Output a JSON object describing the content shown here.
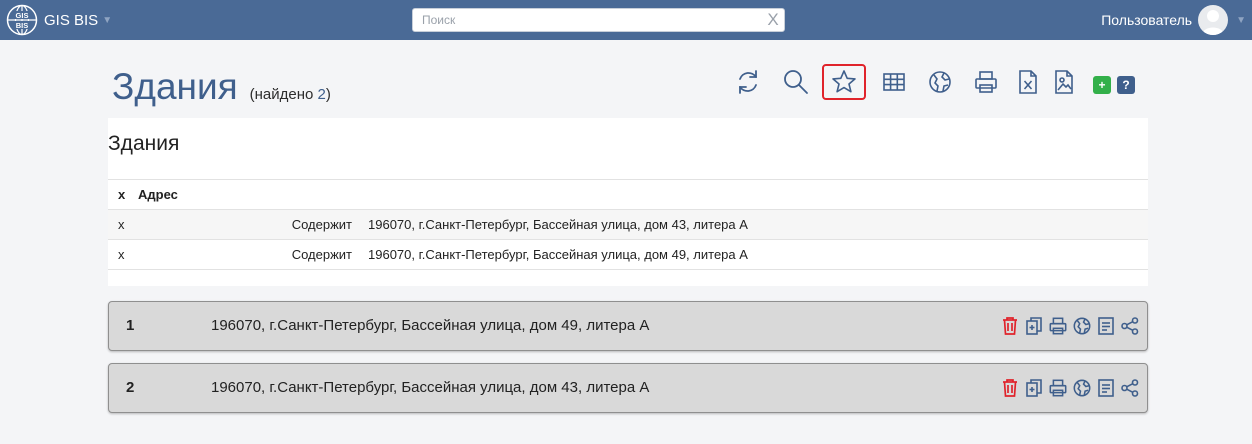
{
  "navbar": {
    "brand": "GIS BIS",
    "search_placeholder": "Поиск",
    "search_clear": "X",
    "user_name": "Пользователь"
  },
  "page": {
    "title": "Здания",
    "found_prefix": "(найдено ",
    "found_count": "2",
    "found_suffix": ")"
  },
  "toolbar": {
    "icons": [
      "refresh-icon",
      "search-icon",
      "star-icon",
      "table-icon",
      "globe-icon",
      "print-icon",
      "excel-icon",
      "image-icon",
      "add-icon",
      "help-icon"
    ],
    "add_label": "+",
    "help_label": "?",
    "highlight_color": "#e0232b"
  },
  "summary": {
    "title": "Здания",
    "headers": [
      "x",
      "Адрес"
    ],
    "rows": [
      {
        "x": "x",
        "type": "Содержит",
        "address": "196070, г.Санкт-Петербург, Бассейная улица, дом 43, литера А"
      },
      {
        "x": "x",
        "type": "Содержит",
        "address": "196070, г.Санкт-Петербург, Бассейная улица, дом 49, литера А"
      }
    ]
  },
  "cards": [
    {
      "num": "1",
      "address": "196070, г.Санкт-Петербург, Бассейная улица, дом 49, литера А"
    },
    {
      "num": "2",
      "address": "196070, г.Санкт-Петербург, Бассейная улица, дом 43, литера А"
    }
  ],
  "card_actions": [
    "trash-icon",
    "copy-icon",
    "print-icon",
    "globe-icon",
    "document-icon",
    "share-icon"
  ],
  "colors": {
    "navbar": "#4a6a96",
    "title": "#3f5f8c",
    "delete": "#e0232b",
    "add_button": "#33b04a"
  }
}
